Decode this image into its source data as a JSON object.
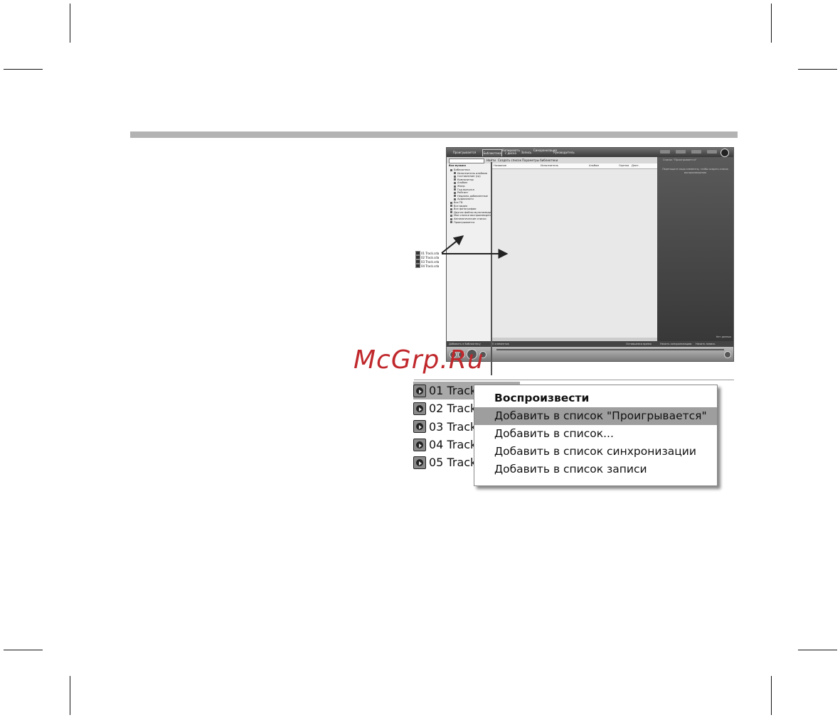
{
  "wmp": {
    "tabs": [
      "Проигрывается",
      "Библиотека",
      "Копировать с диска",
      "Запись",
      "Синхронизация",
      "Руководитель"
    ],
    "subbar": {
      "search_btn": "Найти",
      "create_list": "Создать список",
      "library_label": "Параметры библиотеки"
    },
    "tree_header": "Вся музыка",
    "tree": [
      "Библиотека",
      "Исполнитель альбома",
      "Составление (ср)",
      "Композитор",
      "Альбом",
      "Жанр",
      "Год выпуска",
      "Рейтинг",
      "Недавно добавленные",
      "Аудиокниги",
      "Все ТВ",
      "Все видео",
      "Все фотографии",
      "Другие файлы мультимедиа",
      "Мои списки воспроизведения",
      "Автоматические списки",
      "Проигрывается"
    ],
    "columns": [
      "Название",
      "Исполнитель",
      "Альбом",
      "Оценка",
      "Длит."
    ],
    "right_panel": {
      "title": "Список \"Проигрывается\"",
      "hint": "Перетащите сюда элементы, чтобы создать список воспроизведения",
      "footer": "Нет данных"
    },
    "status": {
      "left": "Добавить в библиотеку",
      "items": "0 элементов",
      "right": "Оставшееся время",
      "sync": "Начать синхронизацию",
      "burn": "Начать запись"
    }
  },
  "mini_tracks": [
    "01 Track.cda",
    "02 Track.cda",
    "03 Track.cda",
    "04 Track.cda"
  ],
  "watermark": "McGrp.Ru",
  "tracks": [
    "01 Track",
    "02 Track",
    "03 Track",
    "04 Track",
    "05 Track"
  ],
  "context_menu": {
    "items": [
      "Воспроизвести",
      "Добавить в список \"Проигрывается\"",
      "Добавить в список...",
      "Добавить в список синхронизации",
      "Добавить в список записи"
    ]
  }
}
